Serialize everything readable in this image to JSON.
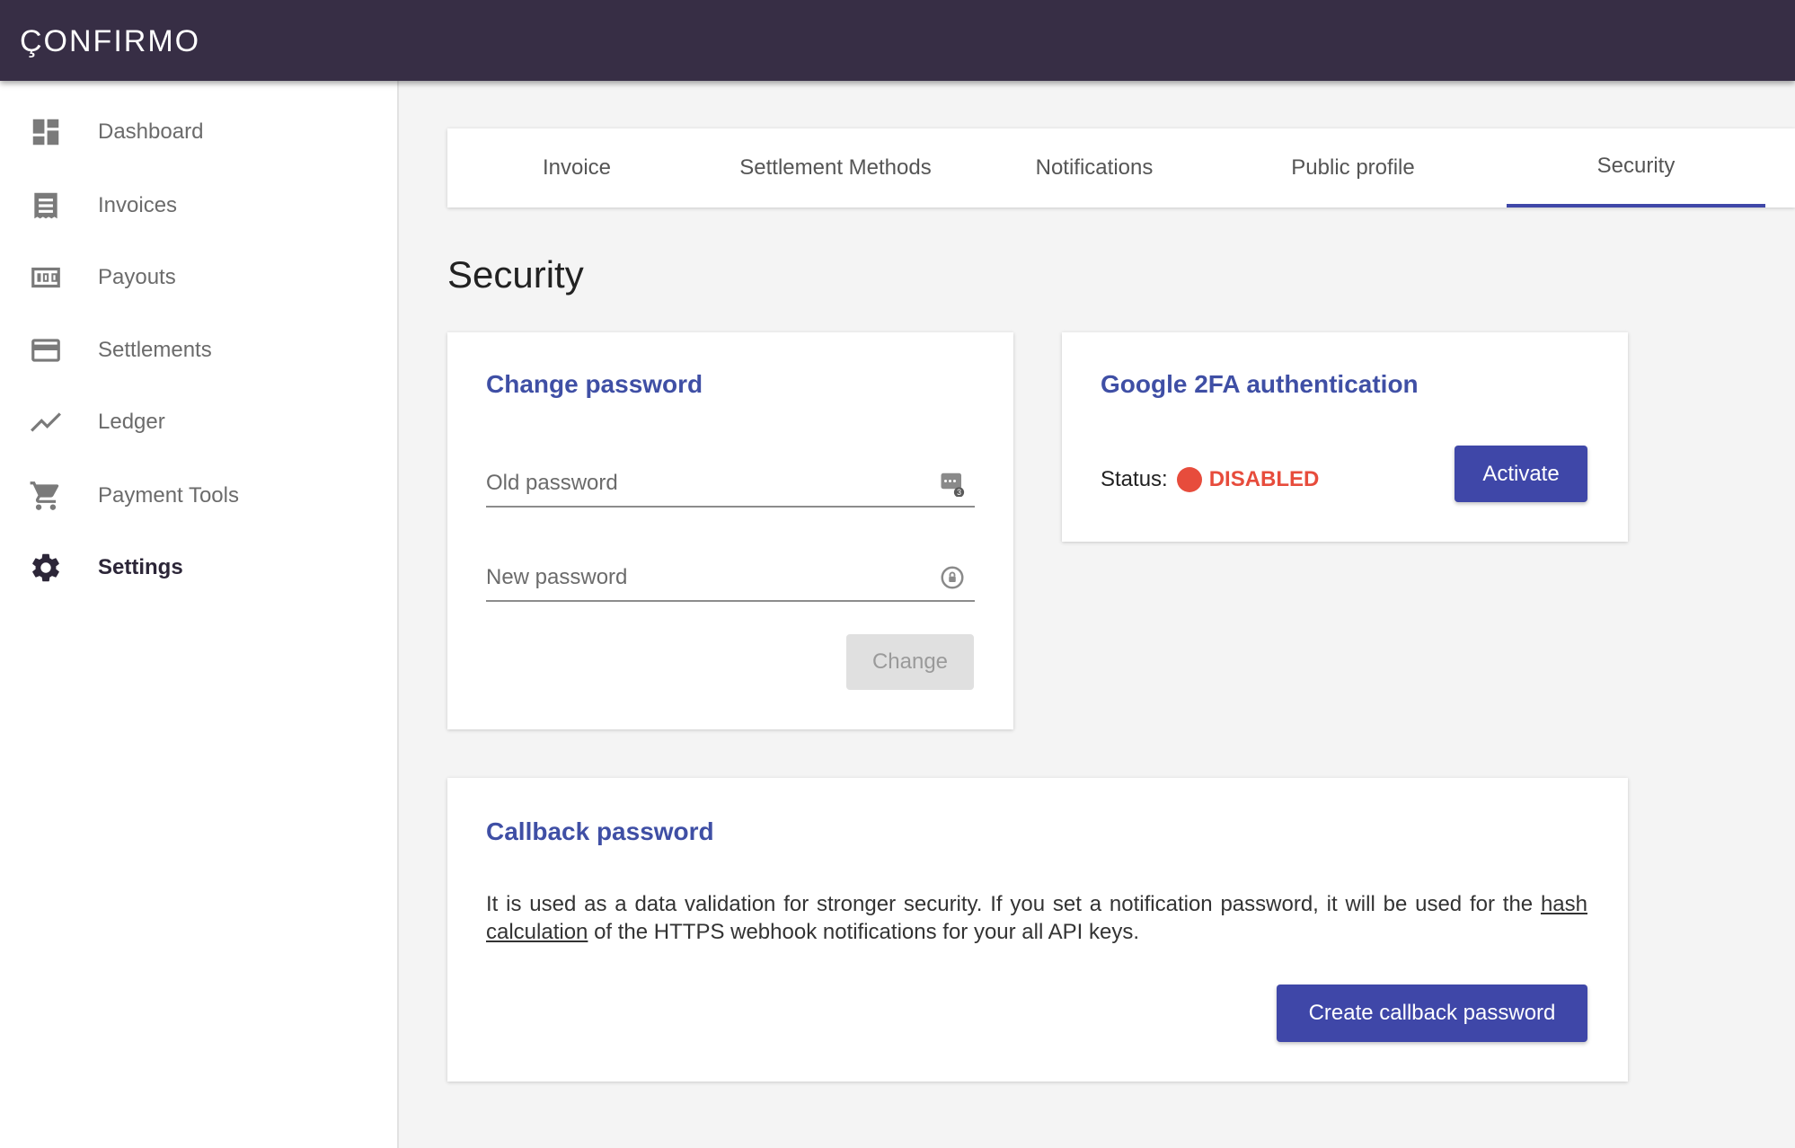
{
  "app": {
    "logo": "ÇONFIRMO"
  },
  "sidebar": {
    "items": [
      {
        "label": "Dashboard",
        "icon": "dashboard-icon"
      },
      {
        "label": "Invoices",
        "icon": "receipt-icon"
      },
      {
        "label": "Payouts",
        "icon": "money-icon"
      },
      {
        "label": "Settlements",
        "icon": "credit-card-icon"
      },
      {
        "label": "Ledger",
        "icon": "trending-line-icon"
      },
      {
        "label": "Payment Tools",
        "icon": "cart-icon"
      },
      {
        "label": "Settings",
        "icon": "gear-icon",
        "active": true
      }
    ]
  },
  "tabs": [
    {
      "label": "Invoice"
    },
    {
      "label": "Settlement Methods"
    },
    {
      "label": "Notifications"
    },
    {
      "label": "Public profile"
    },
    {
      "label": "Security",
      "active": true
    }
  ],
  "page": {
    "title": "Security"
  },
  "change_password": {
    "title": "Change password",
    "old_placeholder": "Old password",
    "new_placeholder": "New password",
    "button": "Change"
  },
  "twofa": {
    "title": "Google 2FA authentication",
    "status_label": "Status:",
    "status_value": "DISABLED",
    "button": "Activate"
  },
  "callback": {
    "title": "Callback password",
    "desc_part1": "It is used as a data validation for stronger security. If you set a notification password, it will be used for the ",
    "desc_link": "hash calculation",
    "desc_part2": " of the HTTPS webhook notifications for your all API keys.",
    "button": "Create callback password"
  },
  "colors": {
    "topbar": "#372e45",
    "accent": "#3f47a8",
    "title_blue": "#3f4fa5",
    "danger": "#e74c3c"
  }
}
